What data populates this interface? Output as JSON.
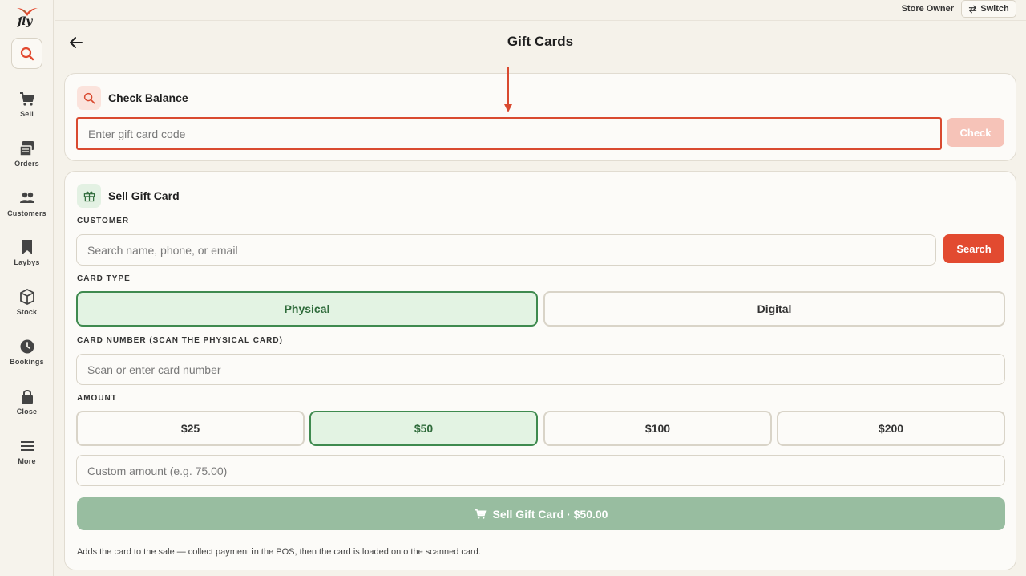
{
  "brand": {
    "name": "fly"
  },
  "sidebar": {
    "items": [
      {
        "label": "Sell",
        "icon": "cart-icon"
      },
      {
        "label": "Orders",
        "icon": "orders-icon"
      },
      {
        "label": "Customers",
        "icon": "customers-icon"
      },
      {
        "label": "Laybys",
        "icon": "bookmark-icon"
      },
      {
        "label": "Stock",
        "icon": "box-icon"
      },
      {
        "label": "Bookings",
        "icon": "clock-icon"
      },
      {
        "label": "Close",
        "icon": "lock-icon"
      },
      {
        "label": "More",
        "icon": "menu-icon"
      }
    ]
  },
  "topbar": {
    "user_role": "Store Owner",
    "switch_label": "Switch"
  },
  "header": {
    "title": "Gift Cards"
  },
  "check_balance": {
    "title": "Check Balance",
    "code_placeholder": "Enter gift card code",
    "check_label": "Check"
  },
  "sell_gift_card": {
    "title": "Sell Gift Card",
    "customer_label": "CUSTOMER",
    "customer_placeholder": "Search name, phone, or email",
    "search_label": "Search",
    "card_type_label": "CARD TYPE",
    "card_types": [
      {
        "label": "Physical",
        "selected": true
      },
      {
        "label": "Digital",
        "selected": false
      }
    ],
    "card_number_label": "CARD NUMBER (SCAN THE PHYSICAL CARD)",
    "card_number_placeholder": "Scan or enter card number",
    "amount_label": "AMOUNT",
    "amounts": [
      {
        "label": "$25",
        "selected": false
      },
      {
        "label": "$50",
        "selected": true
      },
      {
        "label": "$100",
        "selected": false
      },
      {
        "label": "$200",
        "selected": false
      }
    ],
    "custom_amount_placeholder": "Custom amount (e.g. 75.00)",
    "sell_button_label": "Sell Gift Card · $50.00",
    "footnote": "Adds the card to the sale — collect payment in the POS, then the card is loaded onto the scanned card."
  },
  "colors": {
    "accent": "#e24a30",
    "selected_green": "#3f8a4f",
    "sell_button": "#98bda0",
    "check_disabled": "#f6c3b8"
  }
}
